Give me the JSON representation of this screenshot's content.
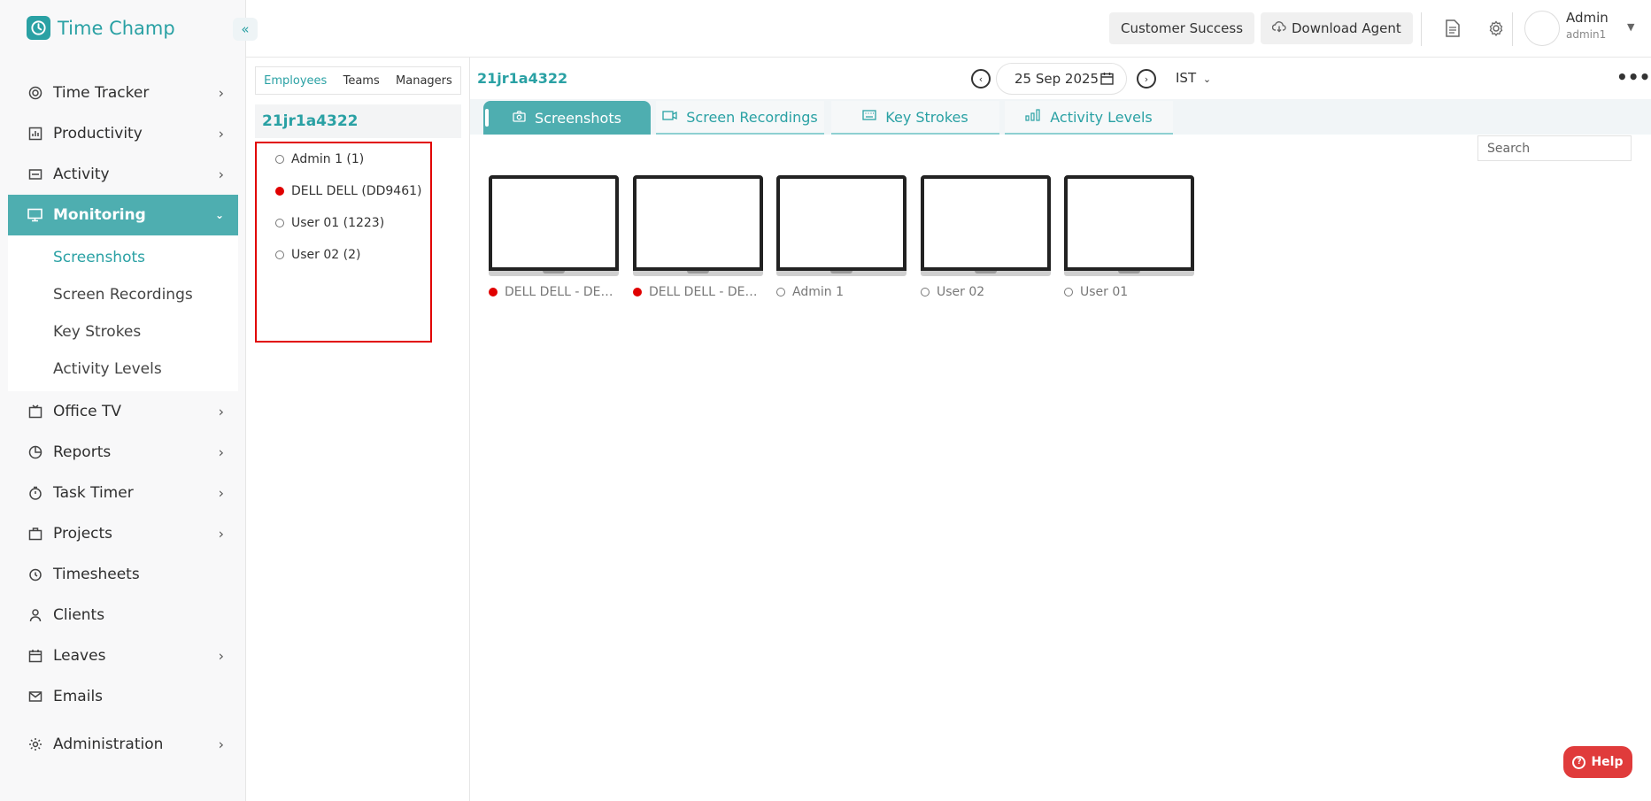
{
  "app": {
    "name": "Time Champ",
    "collapse_glyph": "«"
  },
  "sidebar": {
    "items": [
      {
        "label": "Time Tracker",
        "icon": "time-tracker-icon",
        "has_arrow": true
      },
      {
        "label": "Productivity",
        "icon": "productivity-icon",
        "has_arrow": true
      },
      {
        "label": "Activity",
        "icon": "activity-icon",
        "has_arrow": true
      },
      {
        "label": "Monitoring",
        "icon": "monitor-icon",
        "has_arrow": true,
        "active": true,
        "children": [
          "Screenshots",
          "Screen Recordings",
          "Key Strokes",
          "Activity Levels"
        ]
      },
      {
        "label": "Office TV",
        "icon": "tv-icon",
        "has_arrow": true
      },
      {
        "label": "Reports",
        "icon": "reports-icon",
        "has_arrow": true
      },
      {
        "label": "Task Timer",
        "icon": "timer-icon",
        "has_arrow": true
      },
      {
        "label": "Projects",
        "icon": "projects-icon",
        "has_arrow": true
      },
      {
        "label": "Timesheets",
        "icon": "timesheets-icon",
        "has_arrow": false
      },
      {
        "label": "Clients",
        "icon": "clients-icon",
        "has_arrow": false
      },
      {
        "label": "Leaves",
        "icon": "leaves-icon",
        "has_arrow": true
      },
      {
        "label": "Emails",
        "icon": "emails-icon",
        "has_arrow": false
      },
      {
        "label": "Administration",
        "icon": "admin-icon",
        "has_arrow": true
      }
    ],
    "active_child": "Screenshots"
  },
  "topbar": {
    "customer_success": "Customer Success",
    "download_agent": "Download Agent",
    "user_name": "Admin",
    "user_id": "admin1"
  },
  "employee_panel": {
    "tabs": [
      "Employees",
      "Teams",
      "Managers"
    ],
    "active_tab": "Employees",
    "org_name": "21jr1a4322",
    "employees": [
      {
        "name": "Admin 1 (1)",
        "online": false
      },
      {
        "name": "DELL DELL (DD9461)",
        "online": true
      },
      {
        "name": "User 01 (1223)",
        "online": false
      },
      {
        "name": "User 02 (2)",
        "online": false
      }
    ]
  },
  "main": {
    "org_name": "21jr1a4322",
    "date": "25 Sep 2025",
    "timezone": "IST",
    "tabs": [
      {
        "label": "Screenshots",
        "icon": "camera-icon",
        "active": true
      },
      {
        "label": "Screen Recordings",
        "icon": "video-icon",
        "active": false
      },
      {
        "label": "Key Strokes",
        "icon": "keyboard-icon",
        "active": false
      },
      {
        "label": "Activity Levels",
        "icon": "bars-icon",
        "active": false
      }
    ],
    "search_placeholder": "Search",
    "screenshots": [
      {
        "label": "DELL DELL - DESKT...",
        "online": true
      },
      {
        "label": "DELL DELL - DESKT...",
        "online": true
      },
      {
        "label": "Admin 1",
        "online": false
      },
      {
        "label": "User 02",
        "online": false
      },
      {
        "label": "User 01",
        "online": false
      }
    ]
  },
  "help": {
    "label": "Help"
  },
  "colors": {
    "brand": "#2aa1a4",
    "active_bg": "#4eaeb0",
    "online_dot": "#e00000",
    "help_bg": "#e03b3b"
  }
}
